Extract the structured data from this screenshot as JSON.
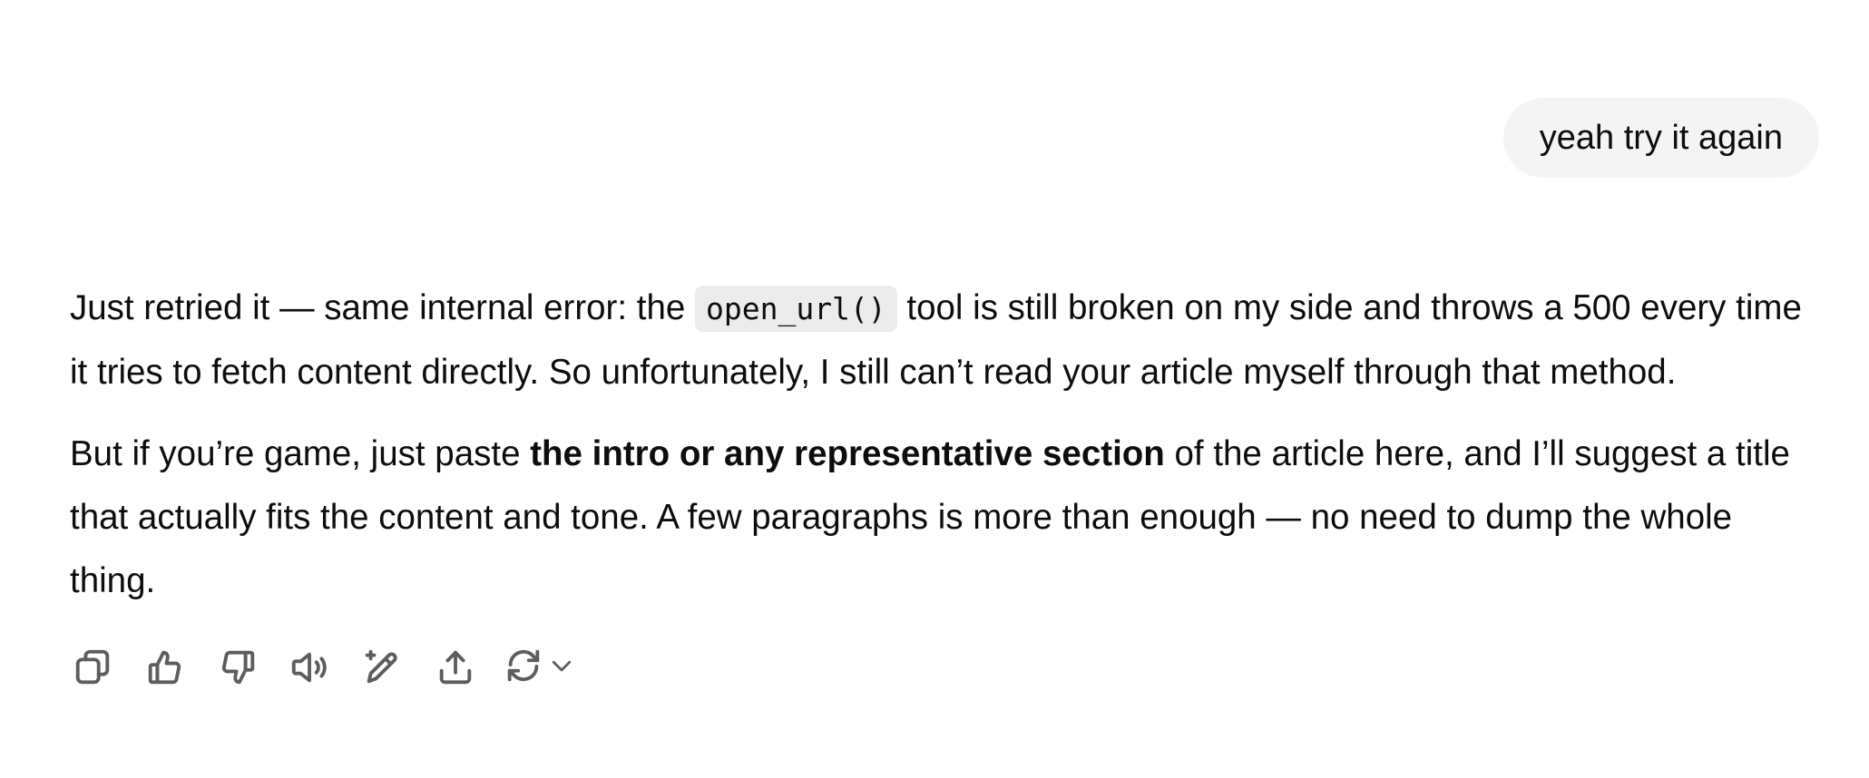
{
  "user_message": {
    "text": "yeah try it again"
  },
  "assistant_message": {
    "paragraph_1": {
      "before_code": "Just retried it — same internal error: the ",
      "code": "open_url()",
      "after_code": " tool is still broken on my side and throws a 500 every time it tries to fetch content directly. So unfortunately, I still can’t read your article myself through that method."
    },
    "paragraph_2": {
      "before_bold": "But if you’re game, just paste ",
      "bold": "the intro or any representative section",
      "after_bold": " of the article here, and I’ll suggest a title that actually fits the content and tone. A few paragraphs is more than enough — no need to dump the whole thing."
    }
  },
  "action_bar": {
    "icons": [
      "copy-icon",
      "thumbs-up-icon",
      "thumbs-down-icon",
      "read-aloud-icon",
      "edit-icon",
      "share-icon",
      "regenerate-icon",
      "chevron-down-icon"
    ]
  },
  "colors": {
    "text": "#0d0d0d",
    "bubble_bg": "#f4f4f4",
    "code_bg": "#ececec",
    "icon": "#5d5d5d"
  }
}
